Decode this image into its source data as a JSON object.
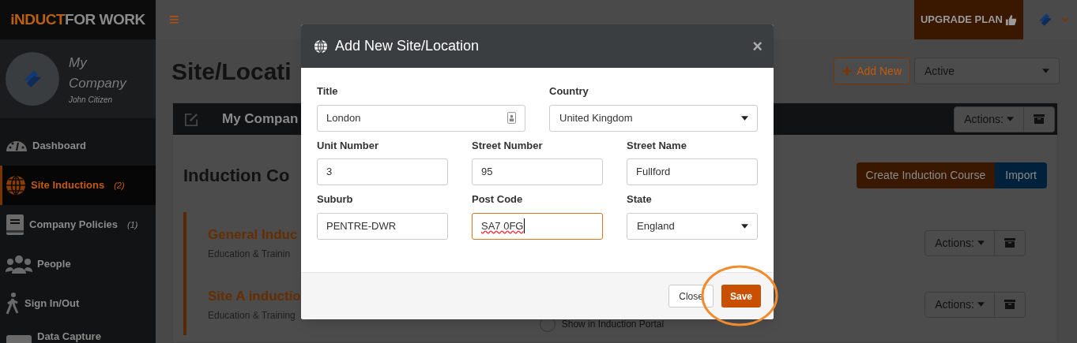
{
  "brand": {
    "logo_accent": "iNDUCT",
    "logo_rest": "FOR WORK"
  },
  "profile": {
    "company": "My Company",
    "user": "John Citizen"
  },
  "sidebar": {
    "items": [
      {
        "label": "Dashboard",
        "selected": false
      },
      {
        "label": "Site Inductions",
        "count": "(2)",
        "selected": true
      },
      {
        "label": "Company Policies",
        "count": "(1)",
        "selected": false
      },
      {
        "label": "People",
        "selected": false
      },
      {
        "label": "Sign In/Out",
        "selected": false
      },
      {
        "label": "Data Capture",
        "selected": false
      }
    ]
  },
  "topbar": {
    "menu_glyph": "≡",
    "upgrade_label": "UPGRADE PLAN"
  },
  "page": {
    "title": "Site/Locati",
    "add_new_label": "Add New",
    "status_filter": "Active",
    "site_card": {
      "name": "My Compan",
      "actions_label": "Actions:",
      "section_title": "Induction Co",
      "create_label": "Create Induction Course",
      "import_label": "Import",
      "courses": [
        {
          "title": "General Induc",
          "category": "Education & Trainin",
          "actions_label": "Actions:"
        },
        {
          "title": "Site A inductio",
          "category": "Education & Training",
          "actions_label": "Actions:",
          "toggle_label": "Show in Induction Portal",
          "toggle_on": false
        }
      ]
    }
  },
  "modal": {
    "title": "Add New Site/Location",
    "close_glyph": "×",
    "rows": [
      [
        {
          "label": "Title",
          "value": "London",
          "kind": "text",
          "focused": false,
          "contact_icon": true
        },
        {
          "label": "Country",
          "value": "United Kingdom",
          "kind": "select",
          "focused": false
        }
      ],
      [
        {
          "label": "Unit Number",
          "value": "3",
          "kind": "text",
          "focused": false,
          "contact_icon": false
        },
        {
          "label": "Street Number",
          "value": "95",
          "kind": "text",
          "focused": false,
          "contact_icon": false
        },
        {
          "label": "Street Name",
          "value": "Fullford",
          "kind": "text",
          "focused": false,
          "contact_icon": false
        }
      ],
      [
        {
          "label": "Suburb",
          "value": "PENTRE-DWR",
          "kind": "text",
          "focused": false,
          "contact_icon": false
        },
        {
          "label": "Post Code",
          "value": "SA7 0FG",
          "kind": "text",
          "focused": true,
          "contact_icon": false
        },
        {
          "label": "State",
          "value": "England",
          "kind": "select",
          "focused": false
        }
      ]
    ],
    "buttons": [
      {
        "label": "Close",
        "kind": "default",
        "circled": false
      },
      {
        "label": "Save",
        "kind": "primary",
        "circled": true
      }
    ]
  }
}
